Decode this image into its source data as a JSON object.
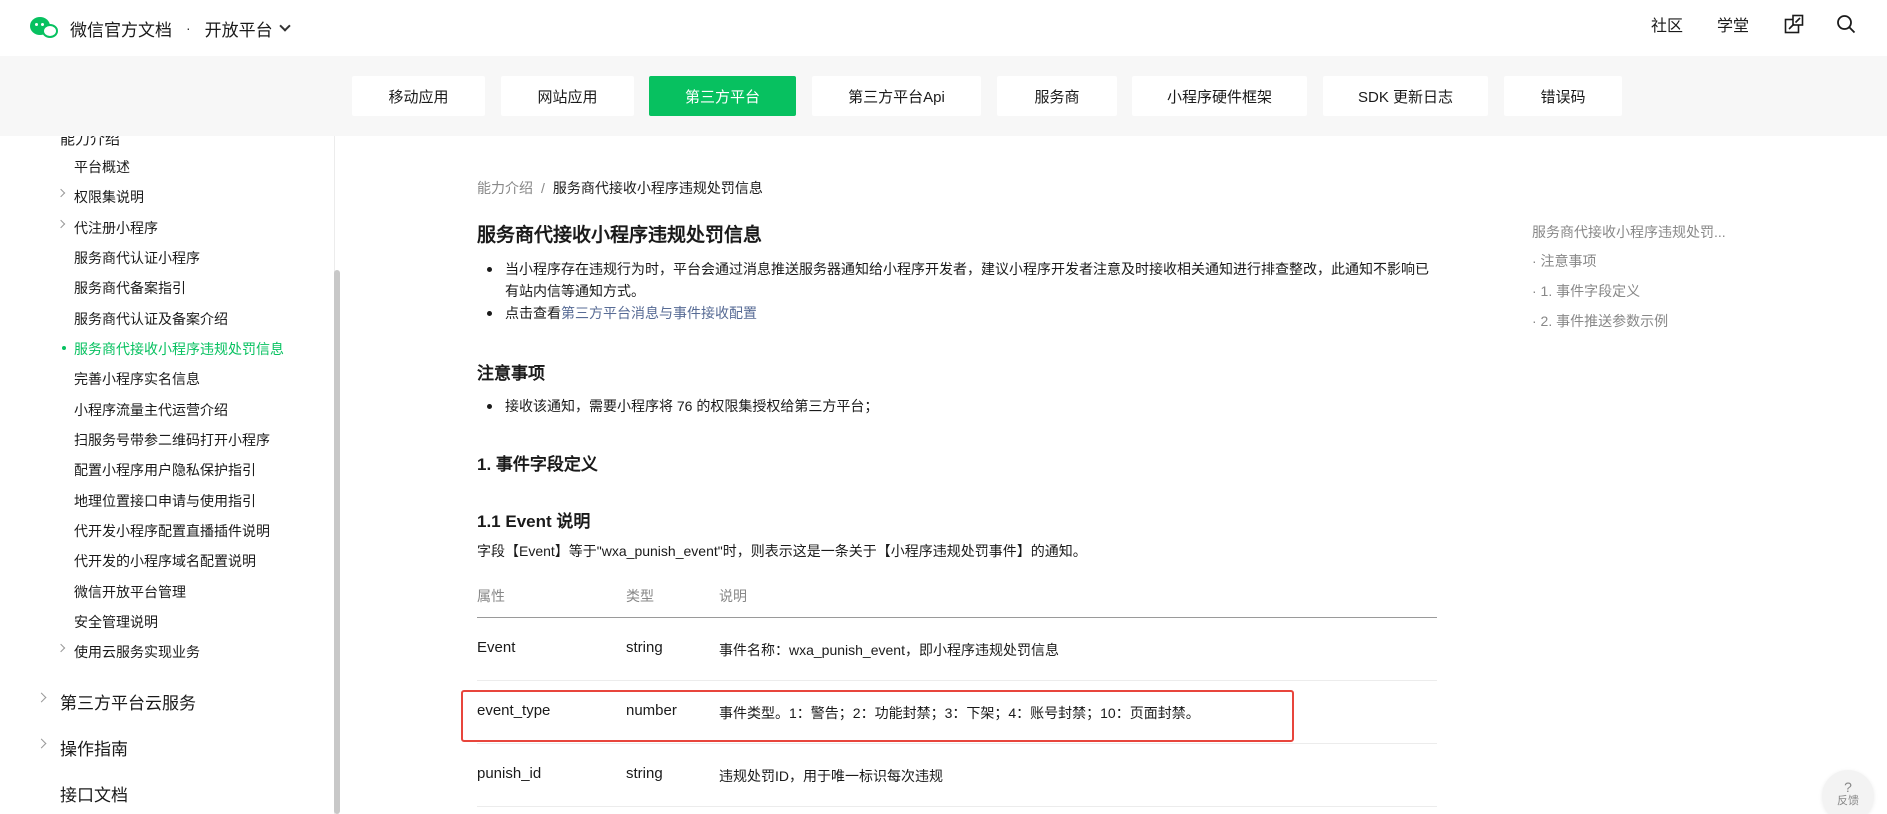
{
  "header": {
    "brand_name": "微信官方文档",
    "separator": "·",
    "platform_label": "开放平台",
    "links": [
      "社区",
      "学堂"
    ]
  },
  "tabs": [
    {
      "label": "移动应用",
      "active": false
    },
    {
      "label": "网站应用",
      "active": false
    },
    {
      "label": "第三方平台",
      "active": true
    },
    {
      "label": "第三方平台Api",
      "active": false
    },
    {
      "label": "服务商",
      "active": false
    },
    {
      "label": "小程序硬件框架",
      "active": false
    },
    {
      "label": "SDK 更新日志",
      "active": false
    },
    {
      "label": "错误码",
      "active": false
    }
  ],
  "sidebar": {
    "clipped_title": "能力介绍",
    "items": [
      {
        "label": "平台概述",
        "caret": false
      },
      {
        "label": "权限集说明",
        "caret": true
      },
      {
        "label": "代注册小程序",
        "caret": true
      },
      {
        "label": "服务商代认证小程序",
        "caret": false
      },
      {
        "label": "服务商代备案指引",
        "caret": false
      },
      {
        "label": "服务商代认证及备案介绍",
        "caret": false
      },
      {
        "label": "服务商代接收小程序违规处罚信息",
        "caret": false,
        "active": true
      },
      {
        "label": "完善小程序实名信息",
        "caret": false
      },
      {
        "label": "小程序流量主代运营介绍",
        "caret": false
      },
      {
        "label": "扫服务号带参二维码打开小程序",
        "caret": false
      },
      {
        "label": "配置小程序用户隐私保护指引",
        "caret": false
      },
      {
        "label": "地理位置接口申请与使用指引",
        "caret": false
      },
      {
        "label": "代开发小程序配置直播插件说明",
        "caret": false
      },
      {
        "label": "代开发的小程序域名配置说明",
        "caret": false
      },
      {
        "label": "微信开放平台管理",
        "caret": false
      },
      {
        "label": "安全管理说明",
        "caret": false
      },
      {
        "label": "使用云服务实现业务",
        "caret": true
      }
    ],
    "sections": [
      {
        "label": "第三方平台云服务",
        "caret": true
      },
      {
        "label": "操作指南",
        "caret": true
      },
      {
        "label": "接口文档",
        "caret": false
      }
    ]
  },
  "main": {
    "breadcrumb_parent": "能力介绍",
    "breadcrumb_sep": "/",
    "breadcrumb_current": "服务商代接收小程序违规处罚信息",
    "title": "服务商代接收小程序违规处罚信息",
    "intro_bullet_1": "当小程序存在违规行为时，平台会通过消息推送服务器通知给小程序开发者，建议小程序开发者注意及时接收相关通知进行排查整改，此通知不影响已有站内信等通知方式。",
    "intro_bullet_2_prefix": "点击查看",
    "intro_bullet_2_link": "第三方平台消息与事件接收配置",
    "notes_heading": "注意事项",
    "notes_bullet": "接收该通知，需要小程序将 76 的权限集授权给第三方平台；",
    "section1_heading": "1. 事件字段定义",
    "section11_heading": "1.1 Event 说明",
    "section11_desc": "字段【Event】等于\"wxa_punish_event\"时，则表示这是一条关于【小程序违规处罚事件】的通知。",
    "table": {
      "headers": [
        "属性",
        "类型",
        "说明"
      ],
      "rows": [
        {
          "name": "Event",
          "type": "string",
          "desc": "事件名称：wxa_punish_event，即小程序违规处罚信息"
        },
        {
          "name": "event_type",
          "type": "number",
          "desc": "事件类型。1：警告；2：功能封禁；3：下架；4：账号封禁；10：页面封禁。",
          "highlighted": true
        },
        {
          "name": "punish_id",
          "type": "string",
          "desc": "违规处罚ID，用于唯一标识每次违规"
        }
      ]
    }
  },
  "toc": {
    "items": [
      "服务商代接收小程序违规处罚...",
      "· 注意事项",
      "· 1. 事件字段定义",
      "· 2. 事件推送参数示例"
    ]
  },
  "feedback": {
    "icon": "?",
    "label": "反馈"
  },
  "colors": {
    "accent": "#07c160",
    "link": "#576b95",
    "highlight_border": "#e8453c"
  }
}
